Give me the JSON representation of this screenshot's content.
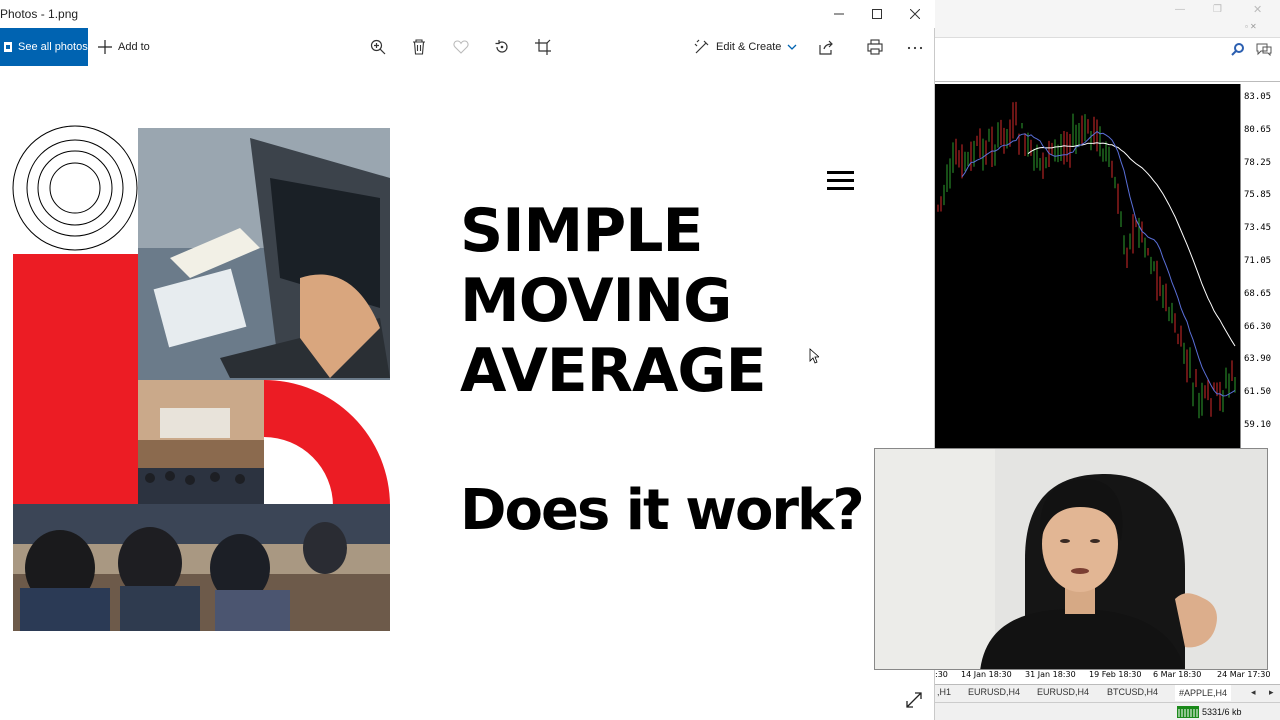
{
  "photos": {
    "title": "Photos - 1.png",
    "toolbar": {
      "see_all": "See all photos",
      "add_to": "Add to",
      "edit_create": "Edit & Create"
    }
  },
  "slide": {
    "line1": "SIMPLE",
    "line2": "MOVING",
    "line3": "AVERAGE",
    "question": "Does it work?"
  },
  "mt4": {
    "price_labels": [
      "83.05",
      "80.65",
      "78.25",
      "75.85",
      "73.45",
      "71.05",
      "68.65",
      "66.30",
      "63.90",
      "61.50",
      "59.10"
    ],
    "date_labels": [
      ":30",
      "14 Jan 18:30",
      "31 Jan 18:30",
      "19 Feb 18:30",
      "6 Mar 18:30",
      "24 Mar 17:30"
    ],
    "tabs": [
      ",H1",
      "EURUSD,H4",
      "EURUSD,H4",
      "BTCUSD,H4",
      "#APPLE,H4"
    ],
    "status": "5331/6 kb"
  },
  "colors": {
    "accent": "#0063b1",
    "red": "#ec1c24",
    "bull": "#2e9e2e",
    "bear": "#d42a2a",
    "ma_fast": "#5a6fd8",
    "ma_slow": "#ffffff"
  }
}
